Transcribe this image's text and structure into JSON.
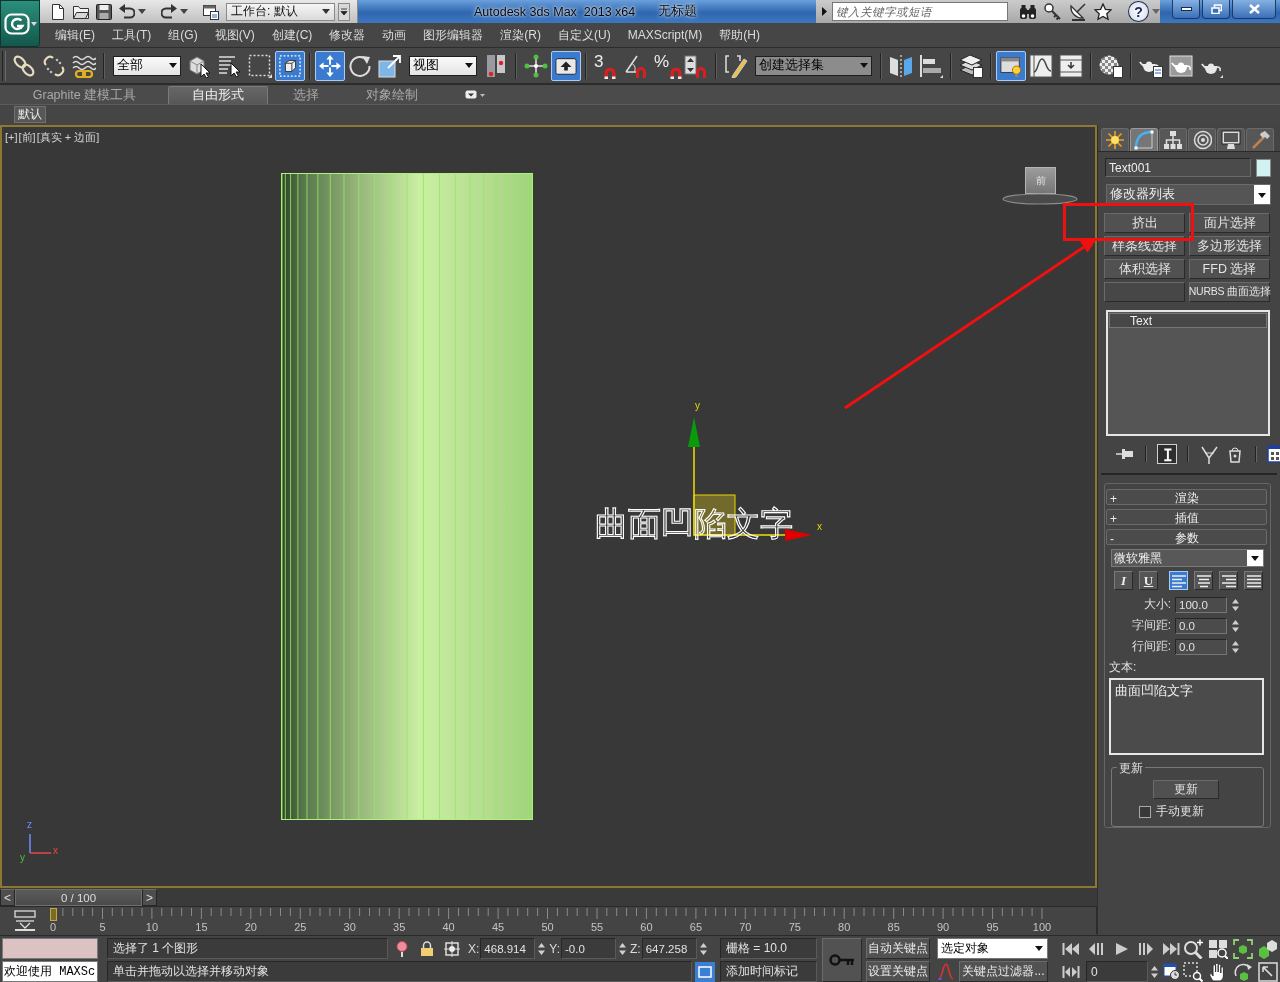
{
  "title_bar": {
    "workspace": "工作台: 默认",
    "app_title": "Autodesk 3ds Max  2013 x64",
    "document_title": "无标题",
    "search": {
      "placeholder": "键入关键字或短语"
    },
    "help": "?"
  },
  "menu_bar": [
    "编辑(E)",
    "工具(T)",
    "组(G)",
    "视图(V)",
    "创建(C)",
    "修改器",
    "动画",
    "图形编辑器",
    "渲染(R)",
    "自定义(U)",
    "MAXScript(M)",
    "帮助(H)"
  ],
  "main_toolbar": [
    {
      "kind": "icon",
      "selected": false
    },
    {
      "kind": "icon",
      "selected": false
    },
    {
      "kind": "icon",
      "selected": false
    },
    {
      "kind": "dropdown",
      "value": "全部"
    },
    {
      "kind": "icon",
      "selected": false
    },
    {
      "kind": "icon",
      "selected": false
    },
    {
      "kind": "icon",
      "selected": false
    },
    {
      "kind": "icon",
      "selected": true
    },
    {
      "kind": "icon",
      "selected": true
    },
    {
      "kind": "icon",
      "selected": false
    },
    {
      "kind": "icon",
      "selected": false
    },
    {
      "kind": "dropdown",
      "value": "视图"
    },
    {
      "kind": "icon",
      "selected": false
    },
    {
      "kind": "icon",
      "selected": false
    },
    {
      "kind": "icon",
      "selected": true
    },
    {
      "kind": "snap",
      "label": "3",
      "selected": false
    },
    {
      "kind": "icon",
      "selected": false
    },
    {
      "kind": "snap",
      "label": "%",
      "selected": false
    },
    {
      "kind": "icon",
      "selected": false
    },
    {
      "kind": "icon",
      "selected": false
    },
    {
      "kind": "dropdown",
      "value": "创建选择集"
    },
    {
      "kind": "icon",
      "selected": false
    },
    {
      "kind": "icon",
      "selected": false
    },
    {
      "kind": "icon",
      "selected": false
    },
    {
      "kind": "icon",
      "selected": true
    },
    {
      "kind": "icon",
      "selected": false
    },
    {
      "kind": "icon",
      "selected": false
    },
    {
      "kind": "icon",
      "selected": false
    },
    {
      "kind": "icon",
      "selected": false
    },
    {
      "kind": "icon",
      "selected": false
    },
    {
      "kind": "icon",
      "selected": false
    }
  ],
  "ribbon": {
    "tabs": [
      {
        "label": "Graphite 建模工具",
        "selected": false
      },
      {
        "label": "自由形式",
        "selected": true
      },
      {
        "label": "选择",
        "selected": false
      },
      {
        "label": "对象绘制",
        "selected": false
      }
    ],
    "panel_button": "默认"
  },
  "viewport": {
    "labels": [
      "[+]",
      "[前]",
      "[真实 + 边面]"
    ],
    "view_cube": "前",
    "shape_text": "曲面凹陷文字",
    "gizmo_axes": [
      "y",
      "x"
    ],
    "tripod_axes": [
      "z",
      "y",
      "x"
    ]
  },
  "command_panel": {
    "tabs": [
      {
        "selected": false
      },
      {
        "selected": true
      },
      {
        "selected": false
      },
      {
        "selected": false
      },
      {
        "selected": false
      },
      {
        "selected": false
      }
    ],
    "object_name": "Text001",
    "modifier_list": "修改器列表",
    "modifier_buttons": [
      {
        "kind": "button",
        "label": "挤出"
      },
      {
        "kind": "button",
        "label": "面片选择"
      },
      {
        "kind": "button",
        "label": "样条线选择"
      },
      {
        "kind": "button",
        "label": "多边形选择"
      },
      {
        "kind": "button",
        "label": "体积选择"
      },
      {
        "kind": "button",
        "label": "FFD 选择"
      },
      {
        "kind": "blank"
      },
      {
        "kind": "button",
        "label": "NURBS 曲面选择"
      }
    ],
    "stack": [
      {
        "label": "Text",
        "selected": true
      }
    ],
    "stack_tools": [
      {
        "selected": false
      },
      {
        "selected": true
      },
      {
        "selected": false
      },
      {
        "selected": false
      },
      {
        "selected": false
      }
    ],
    "rollouts": [
      {
        "sign": "+",
        "title": "渲染"
      },
      {
        "sign": "+",
        "title": "插值"
      },
      {
        "sign": "-",
        "title": "参数"
      }
    ],
    "parameters": {
      "font": "微软雅黑",
      "style_buttons": [
        {
          "kind": "italic",
          "label": "I",
          "selected": false
        },
        {
          "kind": "underline",
          "label": "U",
          "selected": false
        },
        {
          "kind": "left",
          "selected": true
        },
        {
          "kind": "center",
          "selected": false
        },
        {
          "kind": "right",
          "selected": false
        },
        {
          "kind": "justify",
          "selected": false
        }
      ],
      "fields": [
        {
          "label": "大小:",
          "value": "100.0"
        },
        {
          "label": "字间距:",
          "value": "0.0"
        },
        {
          "label": "行间距:",
          "value": "0.0"
        }
      ],
      "text_label": "文本:",
      "text": "曲面凹陷文字",
      "update": {
        "title": "更新",
        "button": "更新",
        "manual": {
          "label": "手动更新",
          "checked": false
        }
      }
    }
  },
  "time_slider": {
    "prev": "<",
    "label": "0 / 100",
    "next": ">",
    "level": 0
  },
  "track_bar": {
    "ticks": [
      "0",
      "5",
      "10",
      "15",
      "20",
      "25",
      "30",
      "35",
      "40",
      "45",
      "50",
      "55",
      "60",
      "65",
      "70",
      "75",
      "80",
      "85",
      "90",
      "95",
      "100"
    ]
  },
  "status_bar": {
    "listener": "欢迎使用 MAXSc",
    "selection": "选择了 1 个图形",
    "prompt": "单击并拖动以选择并移动对象",
    "coordinates": [
      {
        "label": "X:",
        "value": "468.914"
      },
      {
        "label": "Y:",
        "value": "-0.0"
      },
      {
        "label": "Z:",
        "value": "647.258"
      }
    ],
    "grid": "栅格 = 10.0",
    "time_tag": "添加时间标记",
    "auto_key": "自动关键点",
    "set_key": "设置关键点",
    "key_set": "选定对象",
    "key_filters": "关键点过滤器...",
    "frame": "0"
  }
}
